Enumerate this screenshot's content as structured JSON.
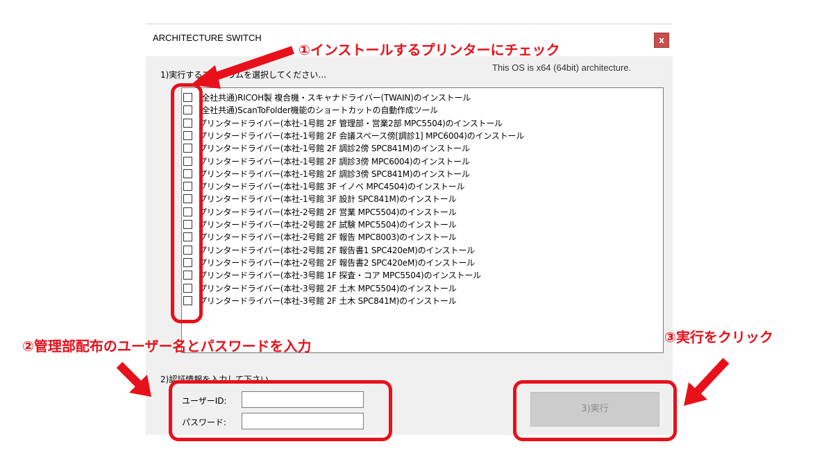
{
  "window": {
    "title": "ARCHITECTURE SWITCH",
    "close_label": "x",
    "os_info": "This OS is x64 (64bit) architecture."
  },
  "step1": {
    "label": "1)実行するプログラムを選択してください…",
    "items": [
      {
        "label": "(全社共通)RICOH製 複合機・スキャナドライバー(TWAIN)のインストール",
        "checked": false
      },
      {
        "label": "(全社共通)ScanToFolder機能のショートカットの自動作成ツール",
        "checked": false
      },
      {
        "label": "プリンタードライバー(本社-1号館 2F 管理部・営業2部 MPC5504)のインストール",
        "checked": false
      },
      {
        "label": "プリンタードライバー(本社-1号館 2F 会議スペース傍[調診1] MPC6004)のインストール",
        "checked": false
      },
      {
        "label": "プリンタードライバー(本社-1号館 2F 調診2傍 SPC841M)のインストール",
        "checked": false
      },
      {
        "label": "プリンタードライバー(本社-1号館 2F 調診3傍 MPC6004)のインストール",
        "checked": false
      },
      {
        "label": "プリンタードライバー(本社-1号館 2F 調診3傍 SPC841M)のインストール",
        "checked": false
      },
      {
        "label": "プリンタードライバー(本社-1号館 3F イノベ MPC4504)のインストール",
        "checked": false
      },
      {
        "label": "プリンタードライバー(本社-1号館 3F 設計 SPC841M)のインストール",
        "checked": false
      },
      {
        "label": "プリンタードライバー(本社-2号館 2F 営業 MPC5504)のインストール",
        "checked": false
      },
      {
        "label": "プリンタードライバー(本社-2号館 2F 試験 MPC5504)のインストール",
        "checked": false
      },
      {
        "label": "プリンタードライバー(本社-2号館 2F 報告 MPC8003)のインストール",
        "checked": false
      },
      {
        "label": "プリンタードライバー(本社-2号館 2F 報告書1 SPC420eM)のインストール",
        "checked": false
      },
      {
        "label": "プリンタードライバー(本社-2号館 2F 報告書2 SPC420eM)のインストール",
        "checked": false
      },
      {
        "label": "プリンタードライバー(本社-3号館 1F 探査・コア MPC5504)のインストール",
        "checked": false
      },
      {
        "label": "プリンタードライバー(本社-3号館 2F 土木 MPC5504)のインストール",
        "checked": false
      },
      {
        "label": "プリンタードライバー(本社-3号館 2F 土木 SPC841M)のインストール",
        "checked": false
      }
    ]
  },
  "step2": {
    "label": "2)認証情報を入力して下さい…",
    "user_id_label": "ユーザーID:",
    "user_id_value": "",
    "password_label": "パスワード:",
    "password_value": ""
  },
  "step3": {
    "execute_label": "3)実行",
    "enabled": false
  },
  "annotations": {
    "color": "#e8101a",
    "note1": "①インストールするプリンターにチェック",
    "note2": "②管理部配布のユーザー名とパスワードを入力",
    "note3": "③実行をクリック"
  }
}
